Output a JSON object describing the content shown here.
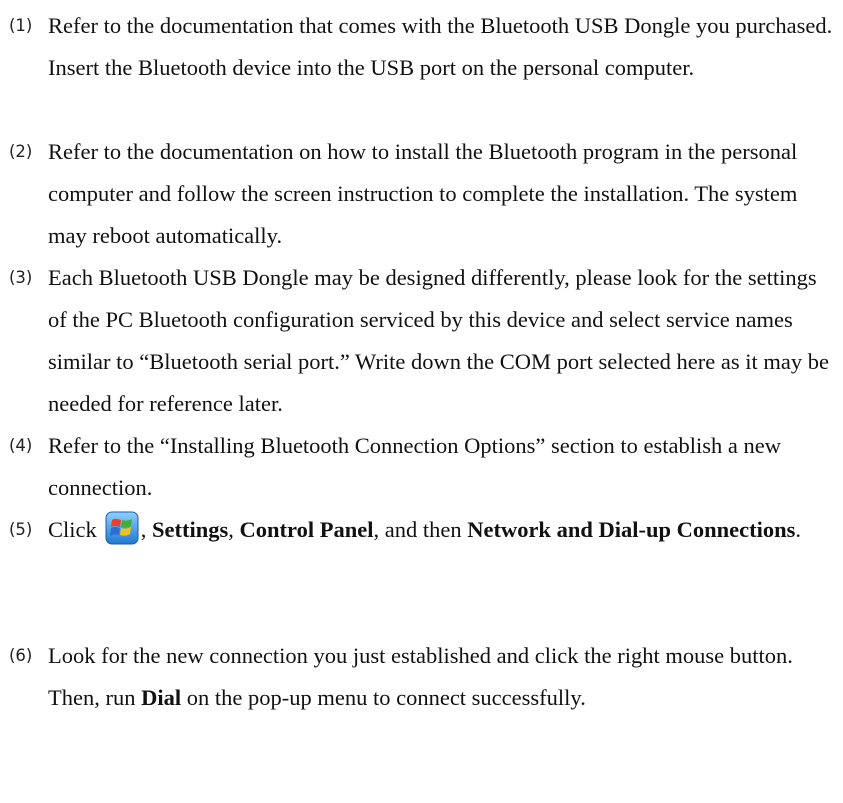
{
  "steps": [
    {
      "number": "(1)",
      "text": "Refer to the documentation that comes with the Bluetooth USB Dongle you purchased. Insert the Bluetooth device into the USB port on the personal computer."
    },
    {
      "number": "(2)",
      "text": "Refer to the documentation on how to install the Bluetooth program in the personal computer and follow the screen instruction to complete the installation. The system may reboot automatically."
    },
    {
      "number": "(3)",
      "text": "Each Bluetooth USB Dongle may be designed differently, please look for the settings of the PC Bluetooth configuration serviced by this device and select service names similar to “Bluetooth serial port.” Write down the COM port selected here as it may be needed for reference later."
    },
    {
      "number": "(4)",
      "text": "Refer to the “Installing Bluetooth Connection Options” section to establish a new connection."
    },
    {
      "number": "(5)",
      "click": "Click",
      "sep1": ", ",
      "settings": "Settings",
      "sep2": ", ",
      "control_panel": "Control Panel",
      "sep3": ", and then ",
      "network": "Network and Dial-up Connections",
      "end": "."
    },
    {
      "number": "(6)",
      "before": "Look for the new connection you just established and click the right mouse button. Then, run ",
      "dial": "Dial",
      "after": " on the pop-up menu to connect successfully."
    }
  ],
  "icons": {
    "start": "windows-start-flag-icon",
    "flag_colors": [
      "#e8402a",
      "#3fae3a",
      "#2b6fd6",
      "#f2c21b"
    ]
  }
}
